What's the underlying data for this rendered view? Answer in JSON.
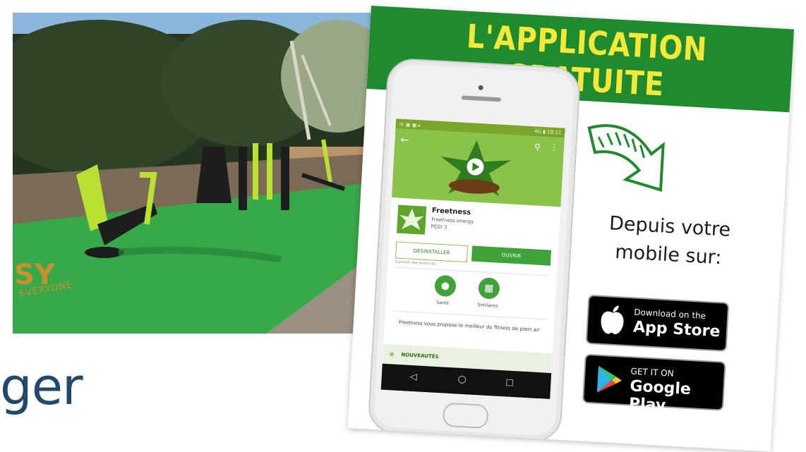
{
  "photo": {
    "logo_text": "SY",
    "logo_subtext": "EVERYONE"
  },
  "page": {
    "partial_title": "ger"
  },
  "flyer": {
    "title": "L'APPLICATION GRATUITE",
    "tagline_line1": "Depuis votre",
    "tagline_line2": "mobile sur:",
    "appstore": {
      "small": "Download on the",
      "big": "App Store"
    },
    "googleplay": {
      "small": "GET IT ON",
      "big": "Google Play"
    }
  },
  "phone_screen": {
    "status_left": "⦿ ▣ ▣ ▸",
    "status_right": "4G ▮ 18:11",
    "app_name": "Freetness",
    "developer": "Freetness energy",
    "rating": "PEGI 3",
    "uninstall_label": "DÉSINSTALLER",
    "open_label": "OUVRIR",
    "ads_note": "Contient des annonces",
    "circle_1_label": "Santé",
    "circle_2_label": "Similaires",
    "description": "Freetness vous propose le meilleur du fitness de plein air",
    "whats_new": "NOUVEAUTÉS"
  },
  "colors": {
    "flyer_green": "#1f8a2e",
    "title_yellow": "#f4e93a",
    "app_green": "#8bc34a",
    "button_green": "#3fa33a",
    "page_title_blue": "#21496b"
  },
  "icons": [
    "back-icon",
    "search-icon",
    "more-icon",
    "apple-icon",
    "google-play-icon",
    "arrow-icon"
  ]
}
